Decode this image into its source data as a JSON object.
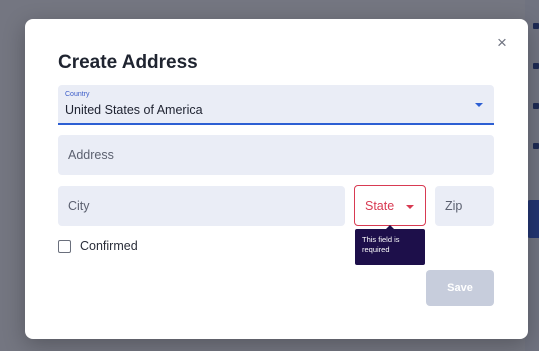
{
  "modal": {
    "title": "Create Address",
    "close_icon": "close-icon",
    "close_glyph": "×"
  },
  "form": {
    "country": {
      "label": "Country",
      "value": "United States of America",
      "icon": "chevron-down-icon"
    },
    "address": {
      "placeholder": "Address",
      "value": ""
    },
    "city": {
      "placeholder": "City",
      "value": ""
    },
    "state": {
      "label": "State",
      "icon": "chevron-down-icon",
      "error": true
    },
    "zip": {
      "placeholder": "Zip",
      "value": ""
    },
    "confirmed": {
      "label": "Confirmed",
      "checked": false
    },
    "state_tooltip": "This field is required",
    "save_label": "Save",
    "save_disabled": true
  },
  "colors": {
    "accent": "#2d5fd3",
    "error": "#d83a52",
    "tooltip_bg": "#1d0f4a",
    "disabled_button": "#c7cddc",
    "input_bg": "#eaedf6"
  }
}
